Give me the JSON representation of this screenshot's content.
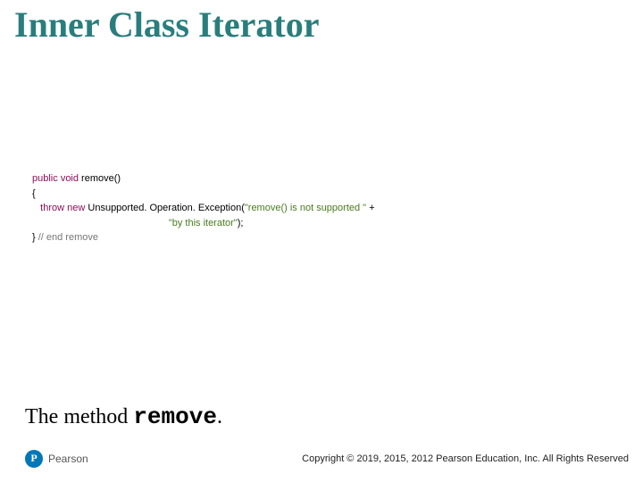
{
  "title": "Inner Class Iterator",
  "code": {
    "l1_kw_public": "public",
    "l1_sp1": " ",
    "l1_kw_void": "void",
    "l1_rest": " remove()",
    "l2": "{",
    "l3_indent": "   ",
    "l3_kw_throw": "throw",
    "l3_sp1": " ",
    "l3_kw_new": "new",
    "l3_rest1": " Unsupported. Operation. Exception(",
    "l3_str1": "\"remove() is not supported \"",
    "l3_plus": " +",
    "l4_indent": "                                                  ",
    "l4_str2": "\"by this iterator\"",
    "l4_rest": ");",
    "l5_brace": "} ",
    "l5_comment": "// end remove"
  },
  "caption": {
    "prefix": "The method ",
    "mono": "remove",
    "suffix": "."
  },
  "footer": {
    "brand": "Pearson",
    "copyright": "Copyright © 2019, 2015, 2012 Pearson Education, Inc. All Rights Reserved"
  }
}
